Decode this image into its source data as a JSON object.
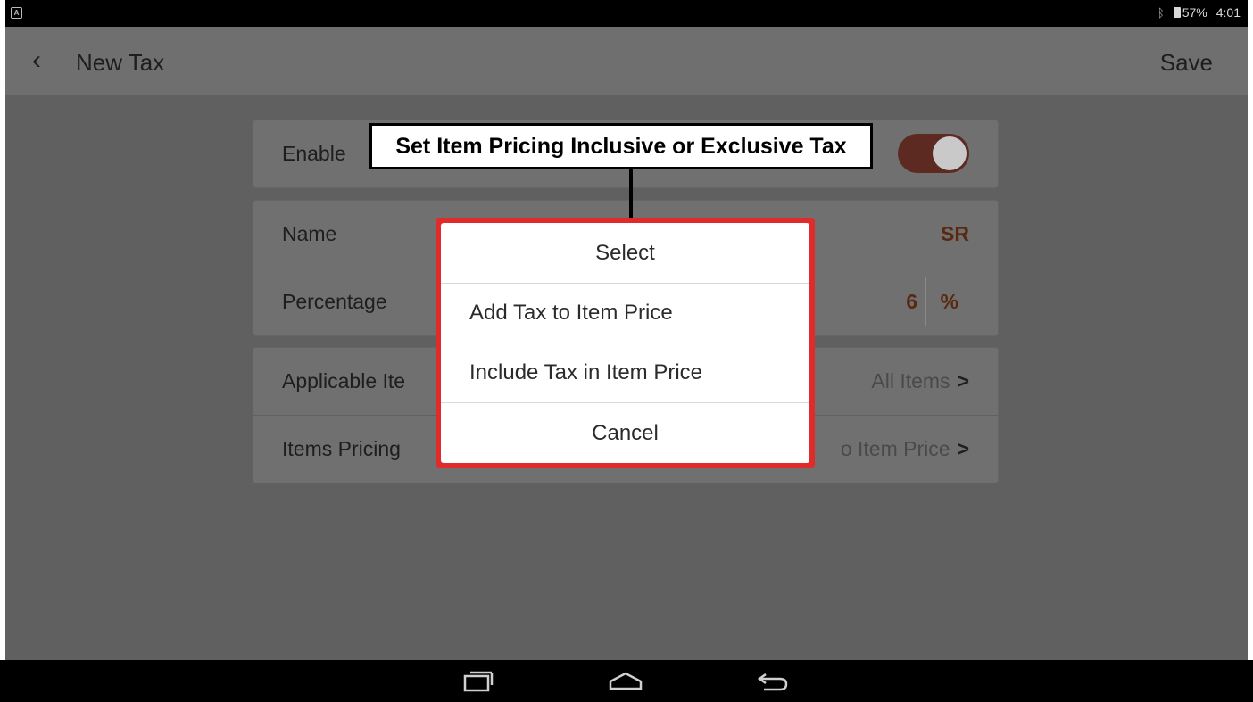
{
  "status_bar": {
    "battery_percent": "57%",
    "time": "4:01",
    "left_icon": "A"
  },
  "header": {
    "title": "New Tax",
    "save_label": "Save"
  },
  "form": {
    "enable_label": "Enable",
    "enabled": true,
    "name_label": "Name",
    "name_value": "SR",
    "percentage_label": "Percentage",
    "percentage_value": "6",
    "percentage_unit": "%",
    "applicable_label": "Applicable Ite",
    "applicable_value": "All  Items",
    "pricing_label": "Items Pricing",
    "pricing_value": "o Item Price"
  },
  "callout": {
    "text": "Set Item Pricing Inclusive or Exclusive Tax"
  },
  "dialog": {
    "title": "Select",
    "options": [
      "Add Tax to Item Price",
      "Include Tax in Item Price"
    ],
    "cancel_label": "Cancel"
  },
  "colors": {
    "accent": "#e12b2b",
    "value_text": "#5a2810"
  }
}
